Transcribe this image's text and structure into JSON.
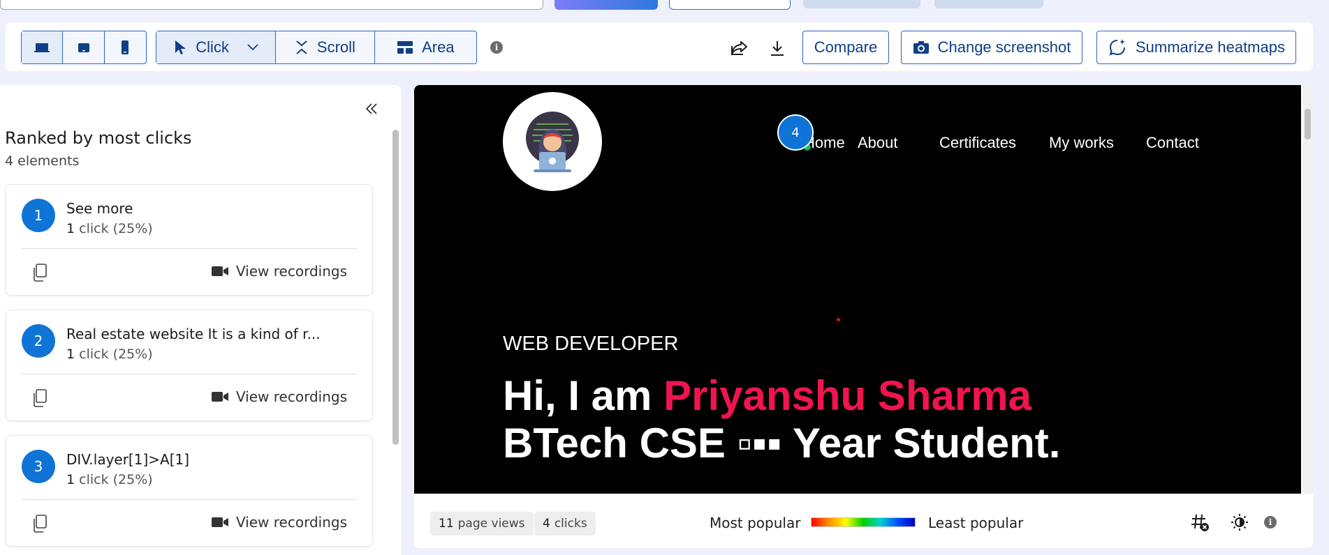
{
  "toolbar": {
    "device_buttons": [
      "desktop-icon",
      "tablet-icon",
      "mobile-icon"
    ],
    "modes": [
      {
        "label": "Click",
        "icon": "cursor-icon"
      },
      {
        "label": "Scroll",
        "icon": "scroll-icon"
      },
      {
        "label": "Area",
        "icon": "area-icon"
      }
    ],
    "compare_label": "Compare",
    "change_screenshot_label": "Change screenshot",
    "summarize_label": "Summarize heatmaps"
  },
  "left_panel": {
    "title": "Ranked by most clicks",
    "subtitle": "4 elements",
    "cards": [
      {
        "rank": "1",
        "title": "See more",
        "count": "1",
        "stat": "click (25%)",
        "action": "View recordings"
      },
      {
        "rank": "2",
        "title": "Real estate website It is a kind of r...",
        "count": "1",
        "stat": "click (25%)",
        "action": "View recordings"
      },
      {
        "rank": "3",
        "title": "DIV.layer[1]>A[1]",
        "count": "1",
        "stat": "click (25%)",
        "action": "View recordings"
      }
    ]
  },
  "site": {
    "nav": [
      "Home",
      "About",
      "Certificates",
      "My works",
      "Contact"
    ],
    "marker_rank": "4",
    "role": "WEB DEVELOPER",
    "headline_prefix": "Hi, I am ",
    "headline_name": "Priyanshu Sharma",
    "headline_line2": "BTech CSE ▫▪▪ Year Student."
  },
  "bottom_bar": {
    "page_views_count": "11",
    "page_views_label": "page views",
    "clicks_count": "4",
    "clicks_label": "clicks",
    "legend_most": "Most popular",
    "legend_least": "Least popular"
  },
  "colors": {
    "accent": "#0f74d6",
    "border": "#2f64c7",
    "name_highlight": "#f0154f"
  }
}
